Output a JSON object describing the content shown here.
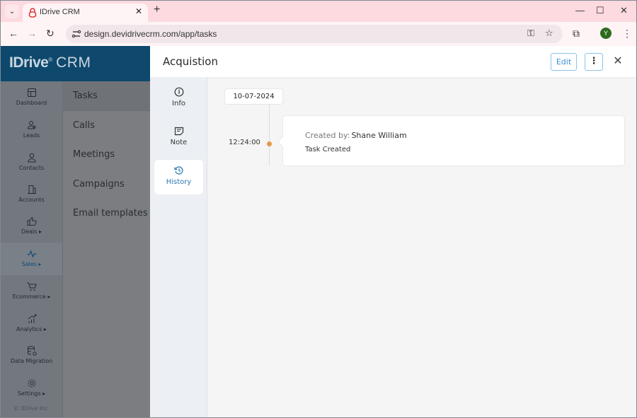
{
  "browser": {
    "tab_title": "IDrive CRM",
    "tab_close": "✕",
    "new_tab": "+",
    "url": "design.devidrivecrm.com/app/tasks",
    "profile_initial": "Y",
    "window_controls": {
      "minimize": "—",
      "maximize": "☐",
      "close": "✕"
    },
    "nav": {
      "back": "←",
      "forward": "→",
      "reload": "↻"
    },
    "icons": {
      "key": "⚿",
      "star": "☆",
      "extensions": "⧉",
      "menu": "⋮",
      "tab_dropdown": "⌄"
    }
  },
  "brand": {
    "name_bold": "IDrive",
    "name_suffix": "CRM",
    "registered": "®"
  },
  "rail": {
    "items": [
      {
        "label": "Dashboard",
        "icon": "dashboard-icon",
        "active": false
      },
      {
        "label": "Leads",
        "icon": "leads-icon",
        "active": false
      },
      {
        "label": "Contacts",
        "icon": "contacts-icon",
        "active": false
      },
      {
        "label": "Accounts",
        "icon": "accounts-icon",
        "active": false
      },
      {
        "label": "Deals ▸",
        "icon": "deals-icon",
        "active": false
      },
      {
        "label": "Sales ▸",
        "icon": "sales-icon",
        "active": true
      },
      {
        "label": "Ecommerce ▸",
        "icon": "ecommerce-icon",
        "active": false
      },
      {
        "label": "Analytics ▸",
        "icon": "analytics-icon",
        "active": false
      },
      {
        "label": "Data Migration",
        "icon": "data-migration-icon",
        "active": false
      },
      {
        "label": "Settings ▸",
        "icon": "settings-icon",
        "active": false
      }
    ],
    "copyright": "© IDrive Inc."
  },
  "subnav": {
    "items": [
      "Tasks",
      "Calls",
      "Meetings",
      "Campaigns",
      "Email templates"
    ],
    "active": "Tasks"
  },
  "panel": {
    "title": "Acquistion",
    "edit_label": "Edit",
    "more_label": "⋮",
    "close_label": "✕",
    "tabs": [
      {
        "label": "Info",
        "icon": "info-icon",
        "active": false
      },
      {
        "label": "Note",
        "icon": "note-icon",
        "active": false
      },
      {
        "label": "History",
        "icon": "history-icon",
        "active": true
      }
    ]
  },
  "history": {
    "date": "10-07-2024",
    "events": [
      {
        "time": "12:24:00",
        "created_by_label": "Created by:",
        "created_by": "Shane William",
        "description": "Task Created"
      }
    ]
  },
  "colors": {
    "brand": "#0e486c",
    "accent": "#3c8fd0",
    "timeline_dot": "#e59a46",
    "tab_bar": "#fdd9e0"
  }
}
